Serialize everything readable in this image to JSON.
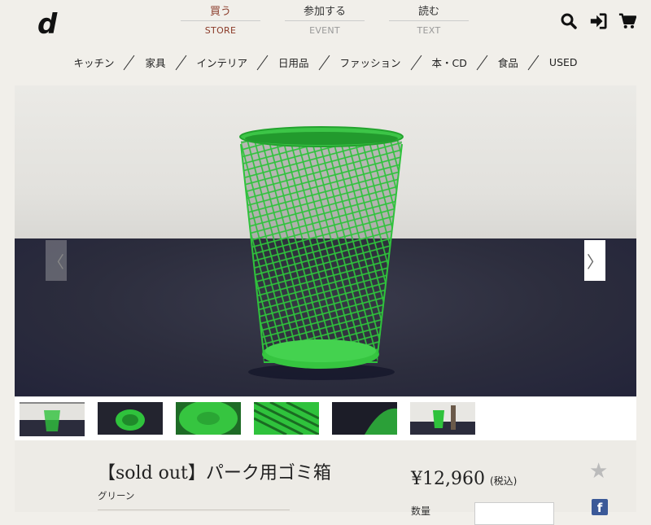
{
  "logo": {
    "text": "d"
  },
  "top_nav": [
    {
      "jp": "買う",
      "en": "STORE",
      "active": true
    },
    {
      "jp": "参加する",
      "en": "EVENT",
      "active": false
    },
    {
      "jp": "読む",
      "en": "TEXT",
      "active": false
    }
  ],
  "header_icons": [
    "search-icon",
    "login-icon",
    "cart-icon"
  ],
  "categories": [
    "キッチン",
    "家具",
    "インテリア",
    "日用品",
    "ファッション",
    "本・CD",
    "食品",
    "USED"
  ],
  "carousel": {
    "prev_label": "〈",
    "next_label": "〉"
  },
  "product": {
    "title": "【sold out】パーク用ゴミ箱",
    "variant": "グリーン",
    "price": "¥12,960",
    "tax_note": "(税込)",
    "quantity_label": "数量"
  },
  "colors": {
    "accent": "#8a3a28",
    "product_green": "#2dbf3a"
  }
}
